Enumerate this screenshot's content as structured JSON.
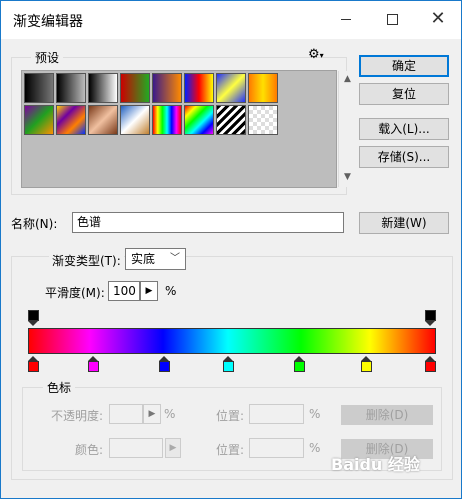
{
  "window": {
    "title": "渐变编辑器"
  },
  "presets": {
    "label": "预设",
    "menu_icon": "gear-icon",
    "swatches": [
      {
        "name": "fg-to-bg",
        "css": "linear-gradient(to right,#000,#777)"
      },
      {
        "name": "fg-to-transparent",
        "css": "linear-gradient(to right,#000,rgba(0,0,0,0))"
      },
      {
        "name": "black-white",
        "css": "linear-gradient(to right,#000,#fff)"
      },
      {
        "name": "red-green",
        "css": "linear-gradient(to right,#c00,#2a2)"
      },
      {
        "name": "violet-orange",
        "css": "linear-gradient(to right,#3a1a8a,#ff8a00)"
      },
      {
        "name": "blue-red-yellow",
        "css": "linear-gradient(to right,#0020ff,#ff0000,#ffff00)"
      },
      {
        "name": "blue-yellow-blue",
        "css": "linear-gradient(135deg,#2030ff,#ffff40,#2030ff)"
      },
      {
        "name": "orange-yellow-orange",
        "css": "linear-gradient(to right,#ff7a00,#ffe000,#ff7a00)"
      },
      {
        "name": "violet-green-orange",
        "css": "linear-gradient(135deg,#8000a0,#20a020,#ff9000)"
      },
      {
        "name": "yellow-violet-orange-blue",
        "css": "linear-gradient(135deg,#ffd000,#7000a0,#ff8000,#0030ff)"
      },
      {
        "name": "copper",
        "css": "linear-gradient(135deg,#7a3a1a,#f0c0a0,#7a3a1a)"
      },
      {
        "name": "chrome",
        "css": "linear-gradient(135deg,#2060c0,#ffffff,#c08030)"
      },
      {
        "name": "spectrum",
        "css": "linear-gradient(to right,#f00,#ff0,#0f0,#0ff,#00f,#f0f,#f00)"
      },
      {
        "name": "transparent-rainbow",
        "css": "linear-gradient(135deg,#f00,#ff0,#0f0,#0ff,#00f,#f0f)"
      },
      {
        "name": "transparent-stripes",
        "css": "repeating-linear-gradient(135deg,#000 0px,#000 3px,#fff 3px,#fff 6px)"
      },
      {
        "name": "transparent-checker",
        "css": "repeating-conic-gradient(#ddd 0% 25%,#fff 0% 50%) 0 0/8px 8px"
      }
    ]
  },
  "buttons": {
    "ok": "确定",
    "reset": "复位",
    "load": "载入(L)...",
    "save": "存储(S)...",
    "new": "新建(W)"
  },
  "name_field": {
    "label": "名称(N):",
    "value": "色谱"
  },
  "gradient": {
    "type_label": "渐变类型(T):",
    "type_value": "实底",
    "smooth_label": "平滑度(M):",
    "smooth_value": "100",
    "smooth_unit": "%",
    "color_stops": [
      {
        "pos": 0,
        "color": "#ff0000"
      },
      {
        "pos": 0.15,
        "color": "#ff00ff"
      },
      {
        "pos": 0.33,
        "color": "#0000ff"
      },
      {
        "pos": 0.49,
        "color": "#00ffff"
      },
      {
        "pos": 0.67,
        "color": "#00ff00"
      },
      {
        "pos": 0.84,
        "color": "#ffff00"
      },
      {
        "pos": 1,
        "color": "#ff0000"
      }
    ],
    "opacity_stops": [
      {
        "pos": 0,
        "color": "#000000"
      },
      {
        "pos": 1,
        "color": "#000000"
      }
    ]
  },
  "stops_group": {
    "label": "色标",
    "opacity_label": "不透明度:",
    "opacity_unit": "%",
    "location_label": "位置:",
    "location_unit": "%",
    "delete_label": "删除(D)",
    "color_label": "颜色:",
    "location2_label": "位置:",
    "location2_unit": "%",
    "delete2_label": "删除(D)"
  },
  "watermark": "Baidu 经验"
}
